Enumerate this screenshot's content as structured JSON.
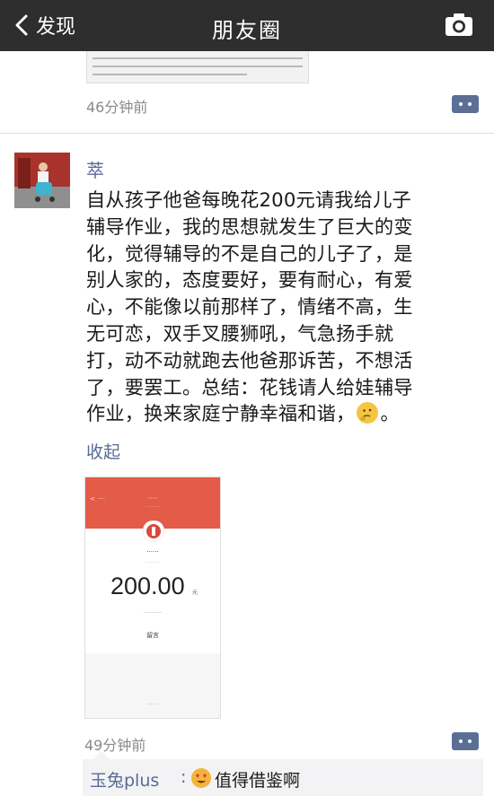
{
  "navbar": {
    "back_label": "发现",
    "title": "朋友圈"
  },
  "previous_post": {
    "time": "46分钟前"
  },
  "post": {
    "author": "萃",
    "text": "自从孩子他爸每晚花200元请我给儿子\n辅导作业，我的思想就发生了巨大的变\n化，觉得辅导的不是自己的儿子了，是\n别人家的，态度要好，要有耐心，有爱\n心，不能像以前那样了，情绪不高，生\n无可恋，双手叉腰狮吼，气急扬手就\n打，动不动就跑去他爸那诉苦，不想活\n了，要罢工。总结：花钱请人给娃辅导\n作业，换来家庭宁静幸福和谐，",
    "text_end": "。",
    "collapse_label": "收起",
    "time": "49分钟前",
    "screenshot": {
      "amount": "200.00",
      "unit": "元",
      "reply_label": "留言"
    }
  },
  "comments": [
    {
      "author": "玉兔plus",
      "separator": ":",
      "text": "值得借鉴啊"
    }
  ],
  "colors": {
    "navbar": "#2e2e2e",
    "link": "#576b95",
    "red_packet": "#e45b47"
  }
}
